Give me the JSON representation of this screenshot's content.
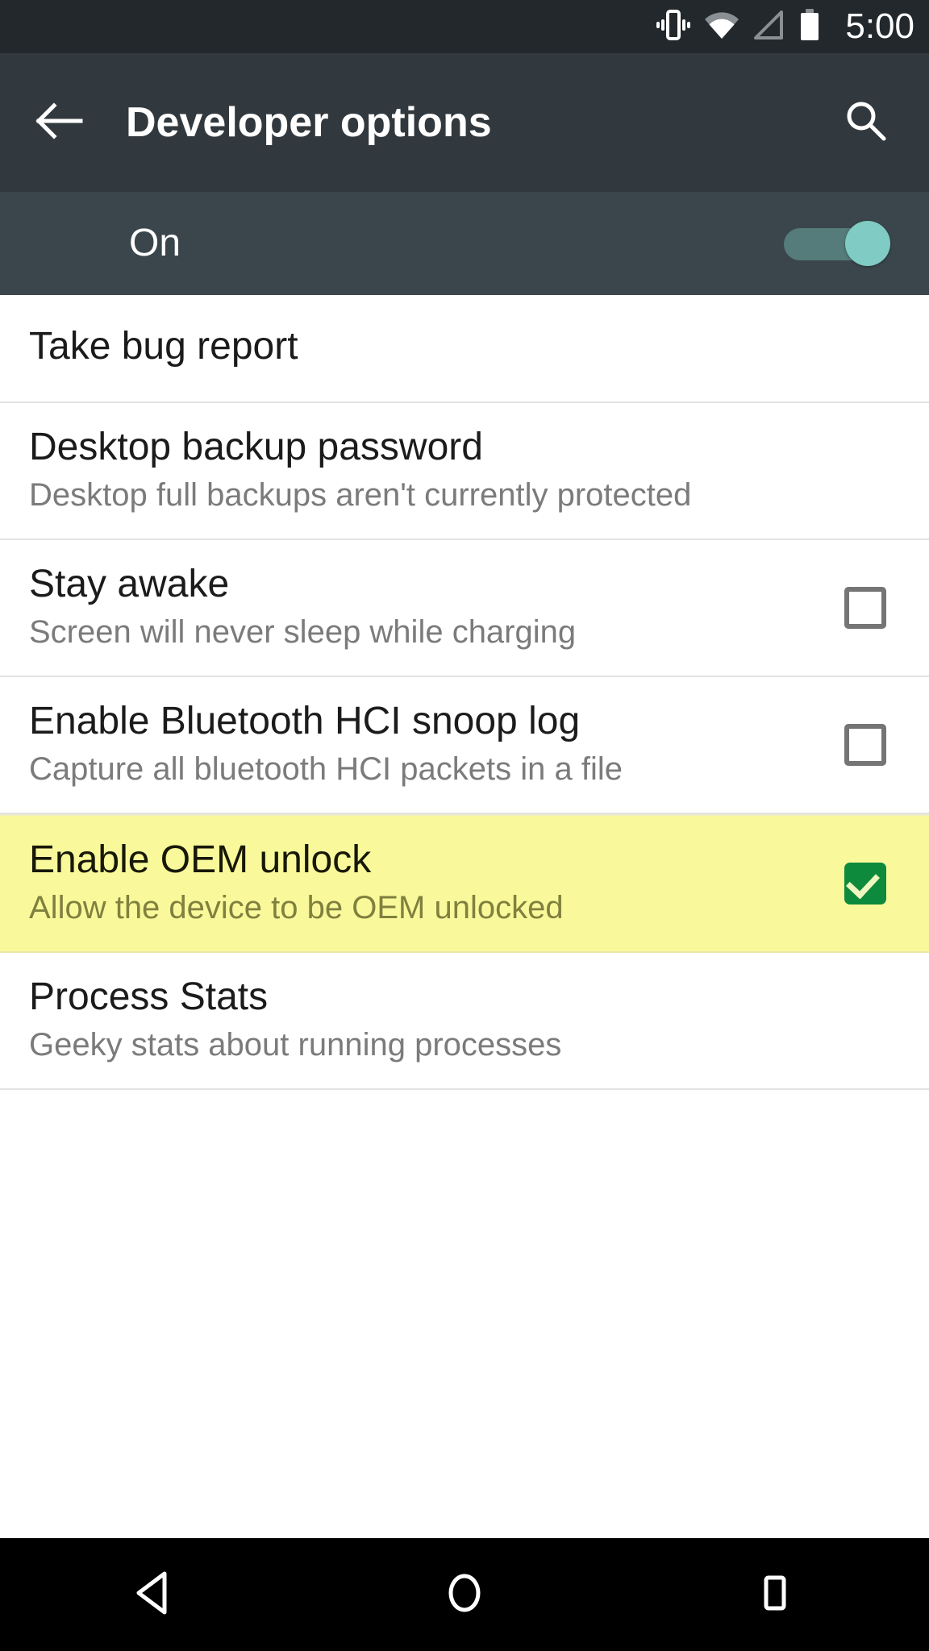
{
  "status_bar": {
    "clock": "5:00",
    "icons": [
      {
        "name": "vibrate-icon",
        "label": "Vibrate"
      },
      {
        "name": "wifi-icon",
        "label": "Wi-Fi"
      },
      {
        "name": "cell-signal-icon",
        "label": "No signal"
      },
      {
        "name": "battery-icon",
        "label": "Battery full"
      }
    ],
    "background_color": "#22282c"
  },
  "app_bar": {
    "title": "Developer options",
    "back_icon": "back-arrow-icon",
    "search_icon": "search-icon",
    "background_color": "#32393e"
  },
  "master_switch": {
    "label": "On",
    "checked": true,
    "thumb_color": "#80cbc4",
    "background_color": "#3a464c"
  },
  "list": {
    "items": [
      {
        "name": "take-bug-report",
        "title": "Take bug report",
        "summary": "",
        "widget": "none",
        "checked": false,
        "highlighted": false
      },
      {
        "name": "desktop-backup-password",
        "title": "Desktop backup password",
        "summary": "Desktop full backups aren't currently protected",
        "widget": "none",
        "checked": false,
        "highlighted": false
      },
      {
        "name": "stay-awake",
        "title": "Stay awake",
        "summary": "Screen will never sleep while charging",
        "widget": "checkbox",
        "checked": false,
        "highlighted": false
      },
      {
        "name": "enable-bluetooth-hci-snoop-log",
        "title": "Enable Bluetooth HCI snoop log",
        "summary": "Capture all bluetooth HCI packets in a file",
        "widget": "checkbox",
        "checked": false,
        "highlighted": false
      },
      {
        "name": "enable-oem-unlock",
        "title": "Enable OEM unlock",
        "summary": "Allow the device to be OEM unlocked",
        "widget": "checkbox",
        "checked": true,
        "highlighted": true
      },
      {
        "name": "process-stats",
        "title": "Process Stats",
        "summary": "Geeky stats about running processes",
        "widget": "none",
        "checked": false,
        "highlighted": false
      }
    ],
    "highlight_color": "#f9f99b",
    "checked_checkbox_color": "#0e8a3c"
  },
  "nav_bar": {
    "background_color": "#000000",
    "buttons": [
      {
        "name": "nav-back-button",
        "icon": "triangle-back-icon"
      },
      {
        "name": "nav-home-button",
        "icon": "circle-home-icon"
      },
      {
        "name": "nav-recents-button",
        "icon": "square-recents-icon"
      }
    ]
  }
}
